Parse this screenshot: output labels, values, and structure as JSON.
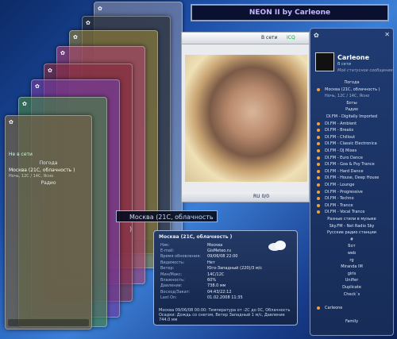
{
  "banner": {
    "title": "NEON II by Carleone"
  },
  "front_skin": {
    "status": "Не в сети",
    "weather_group": "Погода",
    "weather_city": "Москва (21С, облачность )",
    "weather_sub": "Ночь, 12С / 14С, Ясно",
    "radio": "Радио"
  },
  "video": {
    "toolbar_status": "В сети",
    "toolbar_proto": "ICQ",
    "status_bar": "RU   0/0"
  },
  "weather_label": "Москва (21С, облачность )",
  "weather": {
    "header": "Москва (21С, облачность )",
    "rows": [
      {
        "k": "Ник:",
        "v": "Москва"
      },
      {
        "k": "E-mail:",
        "v": "GisMeteo.ru"
      },
      {
        "k": "Время обновления:",
        "v": "09/06/08 22:00"
      },
      {
        "k": "Видимость:",
        "v": "Нет"
      },
      {
        "k": "Ветер:",
        "v": "Юго-Западный (220)/3 м/с"
      },
      {
        "k": "Мин/Макс:",
        "v": "14С/12С"
      },
      {
        "k": "Влажность:",
        "v": "60%"
      },
      {
        "k": "Давление:",
        "v": "738.0 мм"
      },
      {
        "k": "Восход/Закат:",
        "v": "04:43/22:12"
      },
      {
        "k": "Last On:",
        "v": "01.02.2008 11:35"
      }
    ],
    "note": "Москва 09/06/08 00:00: Температура от -2С до 0С, Облачность Осадки: Дождь со снегом, Ветер Западный 1 м/с, Давление 744.0 мм"
  },
  "contacts": {
    "nick": "Carleone",
    "status": "В сети",
    "status_msg": "Моё статусное сообщение",
    "items": [
      {
        "t": "Погода",
        "type": "group"
      },
      {
        "t": "Москва (21С, облачность )",
        "type": "contact"
      },
      {
        "t": "Ночь, 12С / 14С, Ясно",
        "type": "sub"
      },
      {
        "t": "Боты",
        "type": "group"
      },
      {
        "t": "Радио",
        "type": "group"
      },
      {
        "t": "DI.FM - Digitally Imported",
        "type": "group"
      },
      {
        "t": "DI.FM - Ambient",
        "type": "contact"
      },
      {
        "t": "DI.FM - Breaks",
        "type": "contact"
      },
      {
        "t": "DI.FM - Chillout",
        "type": "contact"
      },
      {
        "t": "DI.FM - Classic Electronica",
        "type": "contact"
      },
      {
        "t": "DI.FM - DJ Mixes",
        "type": "contact"
      },
      {
        "t": "DI.FM - Euro Dance",
        "type": "contact"
      },
      {
        "t": "DI.FM - Goa & Psy Trance",
        "type": "contact"
      },
      {
        "t": "DI.FM - Hard Dance",
        "type": "contact"
      },
      {
        "t": "DI.FM - House, Deep House",
        "type": "contact"
      },
      {
        "t": "DI.FM - Lounge",
        "type": "contact"
      },
      {
        "t": "DI.FM - Progressive",
        "type": "contact"
      },
      {
        "t": "DI.FM - Techno",
        "type": "contact"
      },
      {
        "t": "DI.FM - Trance",
        "type": "contact"
      },
      {
        "t": "DI.FM - Vocal Trance",
        "type": "contact"
      },
      {
        "t": "Разные стили в музыке",
        "type": "group"
      },
      {
        "t": "Sky.FM - Net Radio Sky",
        "type": "group"
      },
      {
        "t": "Русские радио станции",
        "type": "group"
      },
      {
        "t": "#",
        "type": "group"
      },
      {
        "t": "Бот",
        "type": "group"
      },
      {
        "t": "web",
        "type": "group"
      },
      {
        "t": "rg",
        "type": "group"
      },
      {
        "t": "Miranda IM",
        "type": "group"
      },
      {
        "t": "girls",
        "type": "group"
      },
      {
        "t": "Unifier",
        "type": "group"
      },
      {
        "t": "Duplicate",
        "type": "group"
      },
      {
        "t": "Check`s",
        "type": "group"
      },
      {
        "t": "",
        "type": "spacer"
      },
      {
        "t": "Carleone",
        "type": "contact"
      },
      {
        "t": "",
        "type": "spacer"
      },
      {
        "t": "Family",
        "type": "group"
      }
    ]
  }
}
